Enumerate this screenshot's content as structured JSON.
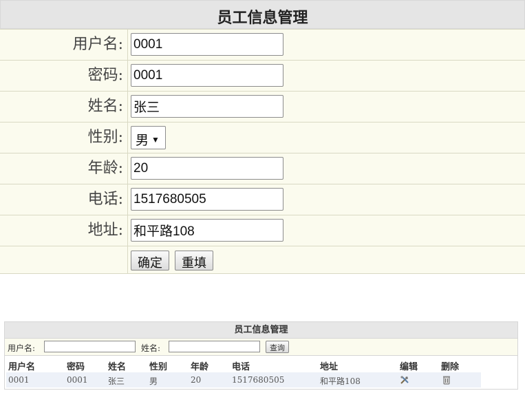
{
  "form": {
    "title": "员工信息管理",
    "fields": {
      "username": {
        "label": "用户名:",
        "value": "0001"
      },
      "password": {
        "label": "密码:",
        "value": "0001"
      },
      "name": {
        "label": "姓名:",
        "value": "张三"
      },
      "gender": {
        "label": "性别:",
        "value": "男"
      },
      "age": {
        "label": "年龄:",
        "value": "20"
      },
      "phone": {
        "label": "电话:",
        "value": "1517680505"
      },
      "address": {
        "label": "地址:",
        "value": "和平路108"
      }
    },
    "buttons": {
      "confirm": "确定",
      "reset": "重填"
    }
  },
  "list": {
    "title": "员工信息管理",
    "search": {
      "username_label": "用户名:",
      "name_label": "姓名:",
      "query_button": "查询"
    },
    "columns": [
      "用户名",
      "密码",
      "姓名",
      "性别",
      "年龄",
      "电话",
      "地址",
      "编辑",
      "删除"
    ],
    "rows": [
      {
        "username": "0001",
        "password": "0001",
        "name": "张三",
        "gender": "男",
        "age": "20",
        "phone": "1517680505",
        "address": "和平路108",
        "edit_icon": "edit-tools-icon",
        "delete_icon": "trash-icon"
      }
    ]
  }
}
